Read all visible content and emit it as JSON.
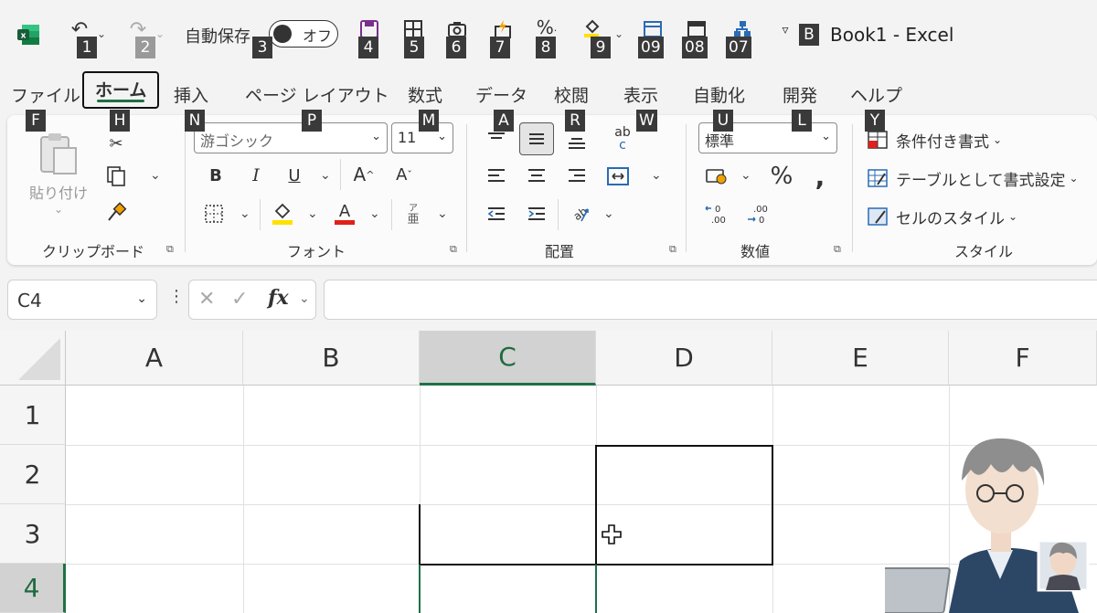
{
  "title_bar": {
    "autosave_label": "自動保存",
    "autosave_state": "オフ",
    "doc_title": "Book1 - Excel",
    "keytips": [
      "1",
      "2",
      "3",
      "4",
      "5",
      "6",
      "7",
      "8",
      "9",
      "09",
      "08",
      "07",
      "B"
    ]
  },
  "tabs": [
    {
      "label": "ファイル",
      "keytip": "F"
    },
    {
      "label": "ホーム",
      "keytip": "H"
    },
    {
      "label": "挿入",
      "keytip": "N"
    },
    {
      "label": "ページ レイアウト",
      "keytip": "P"
    },
    {
      "label": "数式",
      "keytip": "M"
    },
    {
      "label": "データ",
      "keytip": "A"
    },
    {
      "label": "校閲",
      "keytip": "R"
    },
    {
      "label": "表示",
      "keytip": "W"
    },
    {
      "label": "自動化",
      "keytip": "U"
    },
    {
      "label": "開発",
      "keytip": "L"
    },
    {
      "label": "ヘルプ",
      "keytip": "Y"
    }
  ],
  "ribbon": {
    "clipboard": {
      "label": "クリップボード",
      "paste": "貼り付け"
    },
    "font": {
      "label": "フォント",
      "font_name": "游ゴシック",
      "font_size": "11",
      "phonetic_top": "ア",
      "phonetic_bottom": "亜"
    },
    "alignment": {
      "label": "配置",
      "wrap_top": "ab",
      "wrap_bottom": "c"
    },
    "number": {
      "label": "数値",
      "format": "標準"
    },
    "styles": {
      "label": "スタイル",
      "conditional": "条件付き書式",
      "as_table": "テーブルとして書式設定",
      "cell_styles": "セルのスタイル"
    }
  },
  "formula_bar": {
    "name_box": "C4",
    "fx": "fx"
  },
  "grid": {
    "columns": [
      "A",
      "B",
      "C",
      "D",
      "E",
      "F"
    ],
    "rows": [
      "1",
      "2",
      "3",
      "4"
    ],
    "selected_col": "C",
    "selected_row": "4"
  },
  "colors": {
    "accent": "#1e7145",
    "keytip_bg": "#3a3a3a"
  }
}
